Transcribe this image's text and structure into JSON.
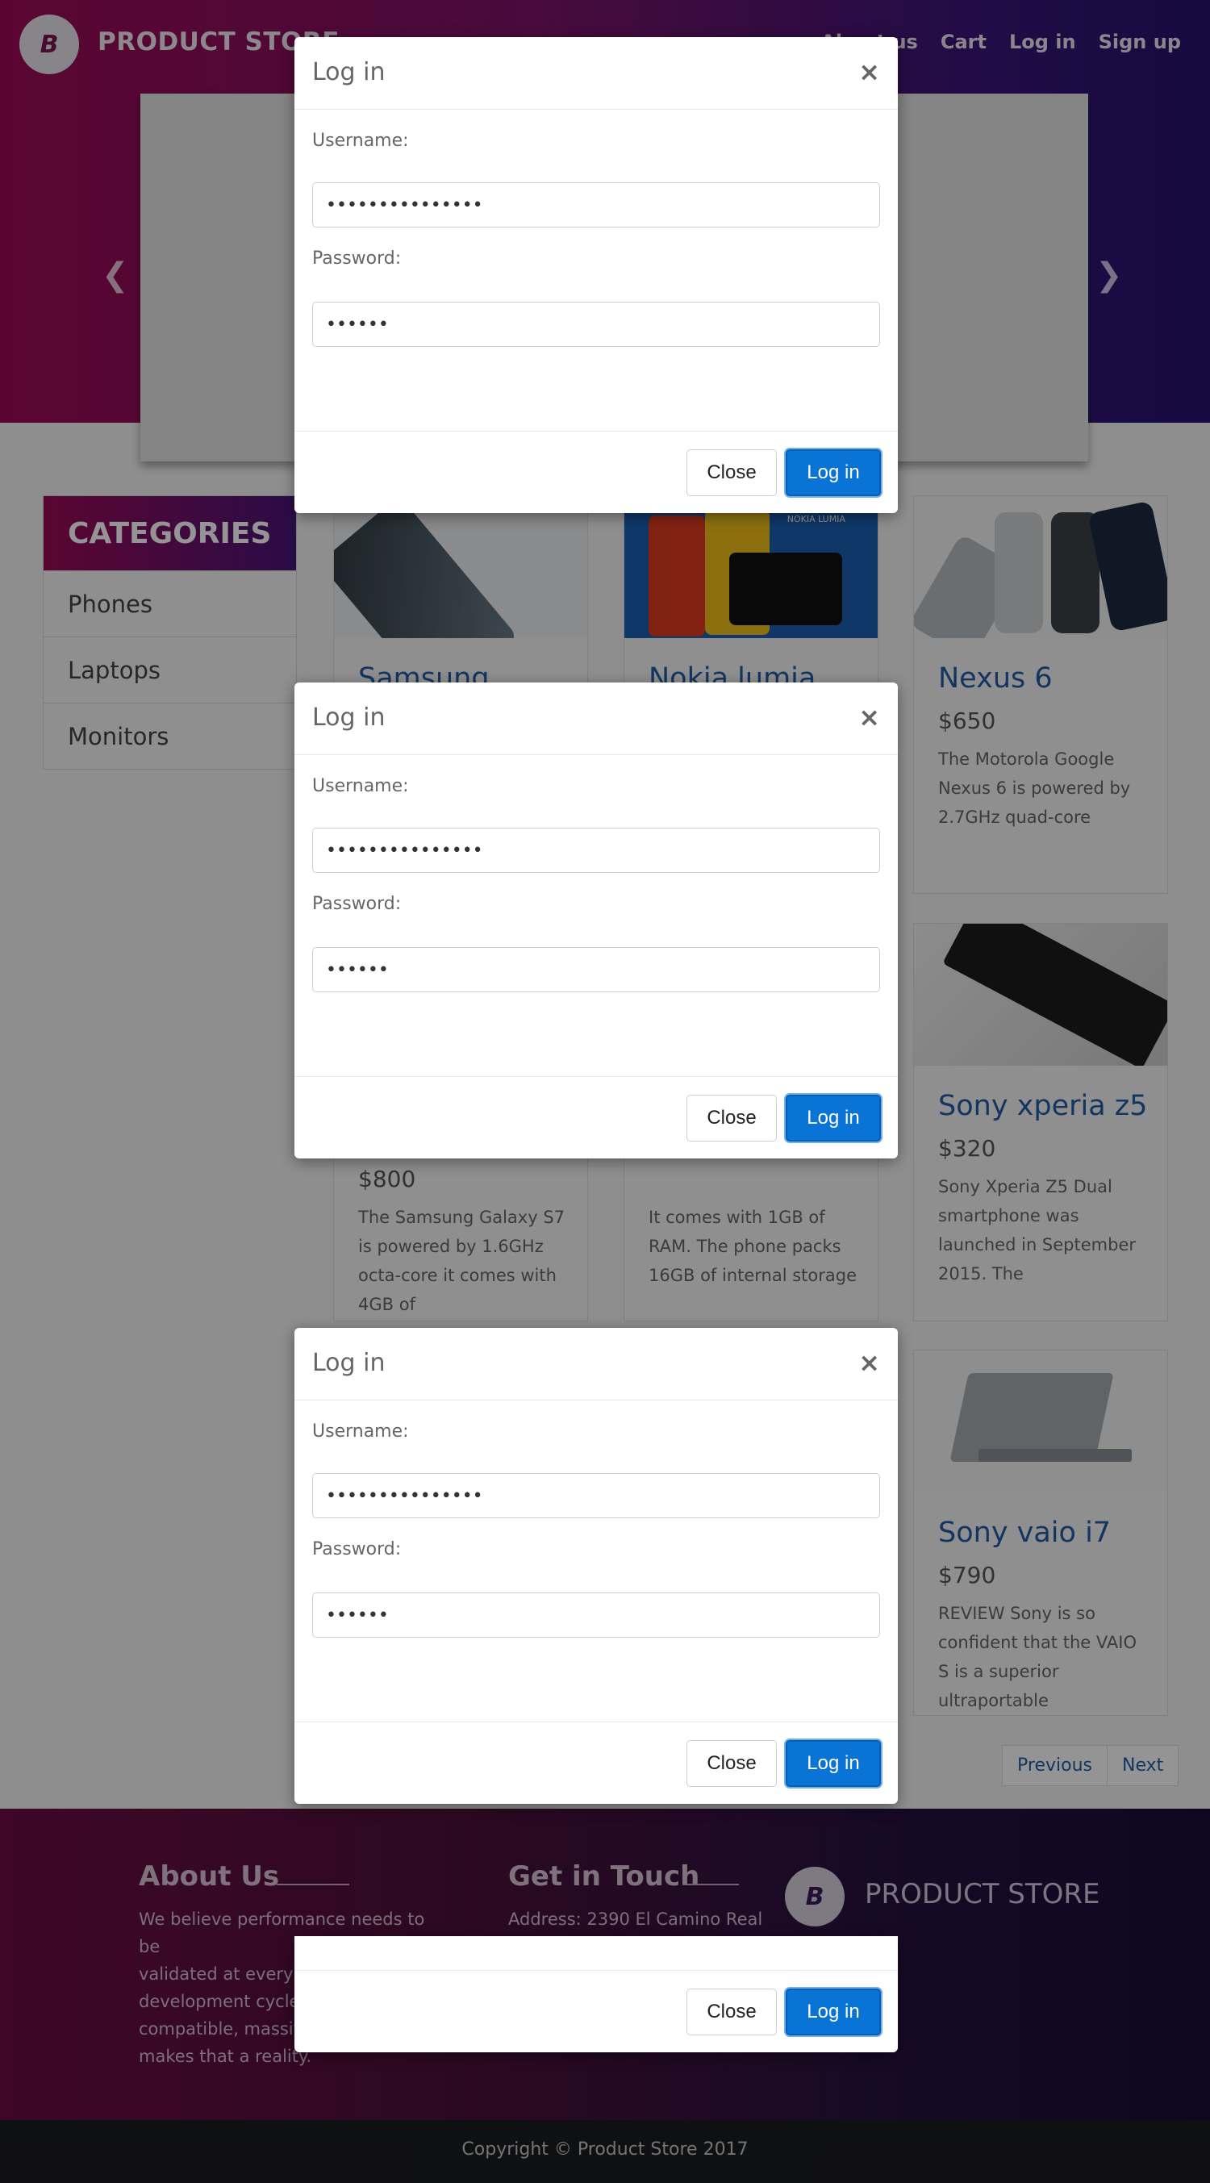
{
  "header": {
    "brand": "PRODUCT STORE",
    "logo_letter": "B",
    "nav": [
      "About us",
      "Cart",
      "Log in",
      "Sign up"
    ]
  },
  "categories": {
    "title": "CATEGORIES",
    "items": [
      "Phones",
      "Laptops",
      "Monitors"
    ]
  },
  "products": [
    {
      "name": "Samsung galaxy",
      "price": "",
      "desc": ""
    },
    {
      "name": "Nokia lumia",
      "price": "",
      "desc": ""
    },
    {
      "name": "Nexus 6",
      "price": "$650",
      "desc": "The Motorola Google Nexus 6 is powered by 2.7GHz quad-core"
    },
    {
      "name": "",
      "price": "$800",
      "desc": "The Samsung Galaxy S7 is powered by 1.6GHz octa-core it comes with 4GB of"
    },
    {
      "name": "",
      "price": "",
      "desc": "It comes with 1GB of RAM. The phone packs 16GB of internal storage"
    },
    {
      "name": "Sony xperia z5",
      "price": "$320",
      "desc": "Sony Xperia Z5 Dual smartphone was launched in September 2015. The"
    },
    {
      "name": "Sony vaio i7",
      "price": "$790",
      "desc": "REVIEW Sony is so confident that the VAIO S is a superior ultraportable"
    }
  ],
  "image_badges": {
    "nokia": "NOKIA LUMIA"
  },
  "pagination": {
    "prev": "Previous",
    "next": "Next"
  },
  "footer": {
    "about_title": "About Us",
    "about_text": "We believe performance needs to be validated at every st... development cycle a... compatible, massive... makes that a reality.",
    "about_lines": [
      "We believe performance needs to be",
      "validated at every st",
      "development cycle a",
      "compatible, massive",
      "makes that a reality."
    ],
    "contact_title": "Get in Touch",
    "contact_address": "Address: 2390 El Camino Real",
    "brand": "PRODUCT STORE",
    "copyright": "Copyright © Product Store 2017"
  },
  "login_modal": {
    "title": "Log in",
    "close_glyph": "×",
    "username_label": "Username:",
    "username_value": "•••••••••••••••",
    "password_label": "Password:",
    "password_value": "••••••",
    "close_button": "Close",
    "login_button": "Log in"
  },
  "colors": {
    "primary_button": "#0a74d6",
    "hero_gradient_start": "#9c0a55",
    "hero_gradient_end": "#26126e",
    "link": "#1f5ea8"
  }
}
